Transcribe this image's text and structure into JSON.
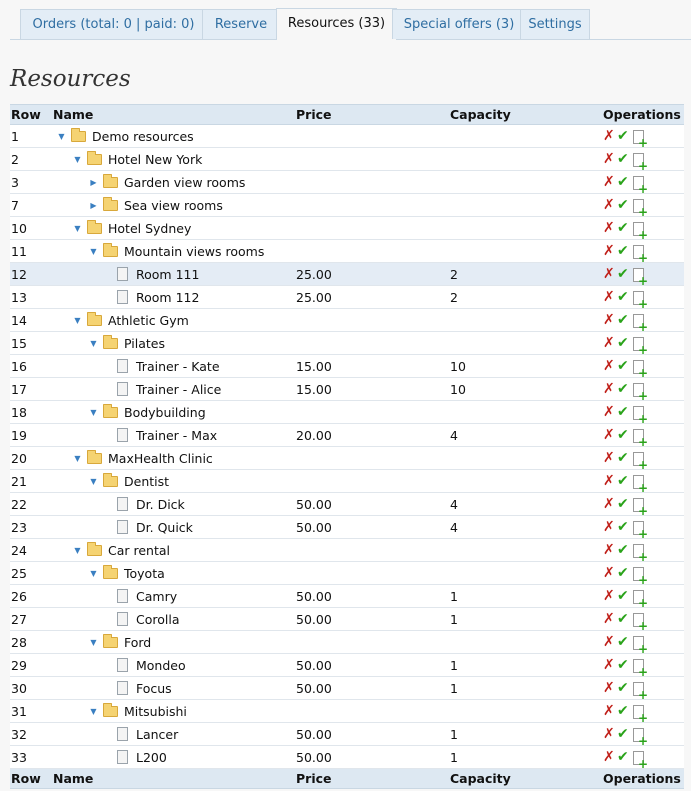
{
  "tabs": [
    {
      "label": "Orders (total: 0 | paid: 0)"
    },
    {
      "label": "Reserve"
    },
    {
      "label": "Resources (33)"
    },
    {
      "label": "Special offers (3)"
    },
    {
      "label": "Settings"
    }
  ],
  "page_title": "Resources",
  "columns": {
    "row": "Row",
    "name": "Name",
    "price": "Price",
    "capacity": "Capacity",
    "operations": "Operations"
  },
  "rows": [
    {
      "row": "1",
      "name": "Demo resources",
      "level": 0,
      "type": "folder",
      "toggle": "open",
      "price": "",
      "capacity": ""
    },
    {
      "row": "2",
      "name": "Hotel New York",
      "level": 1,
      "type": "folder",
      "toggle": "open",
      "price": "",
      "capacity": ""
    },
    {
      "row": "3",
      "name": "Garden view rooms",
      "level": 2,
      "type": "folder",
      "toggle": "closed",
      "price": "",
      "capacity": ""
    },
    {
      "row": "7",
      "name": "Sea view rooms",
      "level": 2,
      "type": "folder",
      "toggle": "closed",
      "price": "",
      "capacity": ""
    },
    {
      "row": "10",
      "name": "Hotel Sydney",
      "level": 1,
      "type": "folder",
      "toggle": "open",
      "price": "",
      "capacity": ""
    },
    {
      "row": "11",
      "name": "Mountain views rooms",
      "level": 2,
      "type": "folder",
      "toggle": "open",
      "price": "",
      "capacity": ""
    },
    {
      "row": "12",
      "name": "Room 111",
      "level": 3,
      "type": "item",
      "price": "25.00",
      "capacity": "2",
      "selected": true
    },
    {
      "row": "13",
      "name": "Room 112",
      "level": 3,
      "type": "item",
      "price": "25.00",
      "capacity": "2"
    },
    {
      "row": "14",
      "name": "Athletic Gym",
      "level": 1,
      "type": "folder",
      "toggle": "open",
      "price": "",
      "capacity": ""
    },
    {
      "row": "15",
      "name": "Pilates",
      "level": 2,
      "type": "folder",
      "toggle": "open",
      "price": "",
      "capacity": ""
    },
    {
      "row": "16",
      "name": "Trainer - Kate",
      "level": 3,
      "type": "item",
      "price": "15.00",
      "capacity": "10"
    },
    {
      "row": "17",
      "name": "Trainer - Alice",
      "level": 3,
      "type": "item",
      "price": "15.00",
      "capacity": "10"
    },
    {
      "row": "18",
      "name": "Bodybuilding",
      "level": 2,
      "type": "folder",
      "toggle": "open",
      "price": "",
      "capacity": ""
    },
    {
      "row": "19",
      "name": "Trainer - Max",
      "level": 3,
      "type": "item",
      "price": "20.00",
      "capacity": "4"
    },
    {
      "row": "20",
      "name": "MaxHealth Clinic",
      "level": 1,
      "type": "folder",
      "toggle": "open",
      "price": "",
      "capacity": ""
    },
    {
      "row": "21",
      "name": "Dentist",
      "level": 2,
      "type": "folder",
      "toggle": "open",
      "price": "",
      "capacity": ""
    },
    {
      "row": "22",
      "name": "Dr. Dick",
      "level": 3,
      "type": "item",
      "price": "50.00",
      "capacity": "4"
    },
    {
      "row": "23",
      "name": "Dr. Quick",
      "level": 3,
      "type": "item",
      "price": "50.00",
      "capacity": "4"
    },
    {
      "row": "24",
      "name": "Car rental",
      "level": 1,
      "type": "folder",
      "toggle": "open",
      "price": "",
      "capacity": ""
    },
    {
      "row": "25",
      "name": "Toyota",
      "level": 2,
      "type": "folder",
      "toggle": "open",
      "price": "",
      "capacity": ""
    },
    {
      "row": "26",
      "name": "Camry",
      "level": 3,
      "type": "item",
      "price": "50.00",
      "capacity": "1"
    },
    {
      "row": "27",
      "name": "Corolla",
      "level": 3,
      "type": "item",
      "price": "50.00",
      "capacity": "1"
    },
    {
      "row": "28",
      "name": "Ford",
      "level": 2,
      "type": "folder",
      "toggle": "open",
      "price": "",
      "capacity": ""
    },
    {
      "row": "29",
      "name": "Mondeo",
      "level": 3,
      "type": "item",
      "price": "50.00",
      "capacity": "1"
    },
    {
      "row": "30",
      "name": "Focus",
      "level": 3,
      "type": "item",
      "price": "50.00",
      "capacity": "1"
    },
    {
      "row": "31",
      "name": "Mitsubishi",
      "level": 2,
      "type": "folder",
      "toggle": "open",
      "price": "",
      "capacity": ""
    },
    {
      "row": "32",
      "name": "Lancer",
      "level": 3,
      "type": "item",
      "price": "50.00",
      "capacity": "1"
    },
    {
      "row": "33",
      "name": "L200",
      "level": 3,
      "type": "item",
      "price": "50.00",
      "capacity": "1"
    }
  ],
  "operations": {
    "delete_icon": "✗",
    "approve_icon": "✔",
    "add_icon": "add-document-icon"
  },
  "colors": {
    "tab_bg": "#e3edf6",
    "tab_text": "#2f6ea2",
    "header_bg": "#dde8f2",
    "selected_row": "#e4ecf5",
    "delete": "#c0201a",
    "approve": "#2aa31a"
  }
}
